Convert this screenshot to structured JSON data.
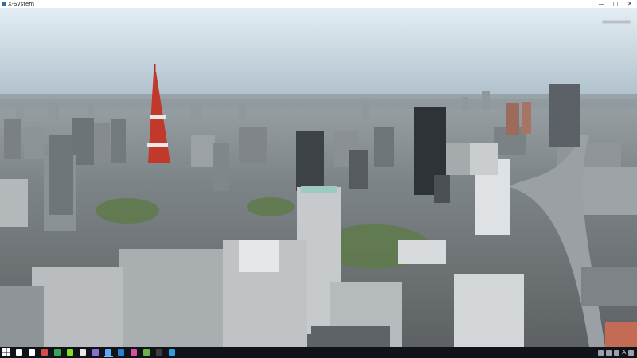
{
  "window": {
    "title": "X-System",
    "minimize": "—",
    "maximize": "□",
    "close": "✕"
  },
  "colors": {
    "sky_top": "#dde8ef",
    "sky_horizon": "#aebfcb",
    "ground": "#6f7577",
    "tower_red": "#c0392b",
    "taskbar": "#101317"
  },
  "taskbar": {
    "start": "windows-start-icon",
    "items": [
      {
        "icon": "search-icon",
        "color": "#ffffff"
      },
      {
        "icon": "task-view-icon",
        "color": "#ffffff"
      },
      {
        "icon": "app-icon",
        "color": "#d64b4b"
      },
      {
        "icon": "app-icon",
        "color": "#3aa655"
      },
      {
        "icon": "app-icon",
        "color": "#7ee321"
      },
      {
        "icon": "app-icon",
        "color": "#e8e8e8"
      },
      {
        "icon": "app-icon",
        "color": "#8a6fd1"
      },
      {
        "icon": "x-system-icon",
        "color": "#5aa9ff",
        "active": true
      },
      {
        "icon": "app-icon",
        "color": "#2c7fd6"
      },
      {
        "icon": "app-icon",
        "color": "#d94fa0"
      },
      {
        "icon": "app-icon",
        "color": "#6bb34a"
      },
      {
        "icon": "app-icon",
        "color": "#3c3c3c"
      },
      {
        "icon": "edge-icon",
        "color": "#2f9be0"
      }
    ],
    "tray_text": "A"
  }
}
